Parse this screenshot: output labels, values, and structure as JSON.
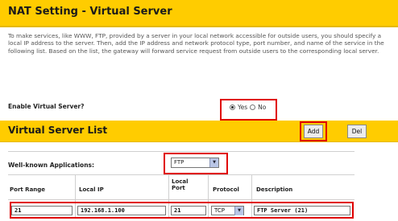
{
  "header": {
    "title": "NAT Setting - Virtual Server"
  },
  "description": "To make services, like WWW, FTP, provided by a server in your local network accessible for outside users, you should specify a local IP address to the server. Then, add the IP address and network protocol type, port number, and name of the service in the following list. Based on the list, the gateway will forward service request from outside users to the corresponding local server.",
  "enable": {
    "label": "Enable Virtual Server?",
    "yes_label": "Yes",
    "no_label": "No",
    "selected": "Yes"
  },
  "list": {
    "title": "Virtual Server List",
    "add_label": "Add",
    "del_label": "Del"
  },
  "well_known": {
    "label": "Well-known Applications:",
    "selected": "FTP"
  },
  "table": {
    "headers": [
      "Port Range",
      "Local IP",
      "Local Port",
      "Protocol",
      "Description"
    ],
    "row": {
      "port_range": "21",
      "local_ip": "192.168.1.100",
      "local_port": "21",
      "protocol": "TCP",
      "description": "FTP Server (21)"
    }
  },
  "colors": {
    "header_bg": "#ffcc00",
    "highlight": "#e00000"
  }
}
